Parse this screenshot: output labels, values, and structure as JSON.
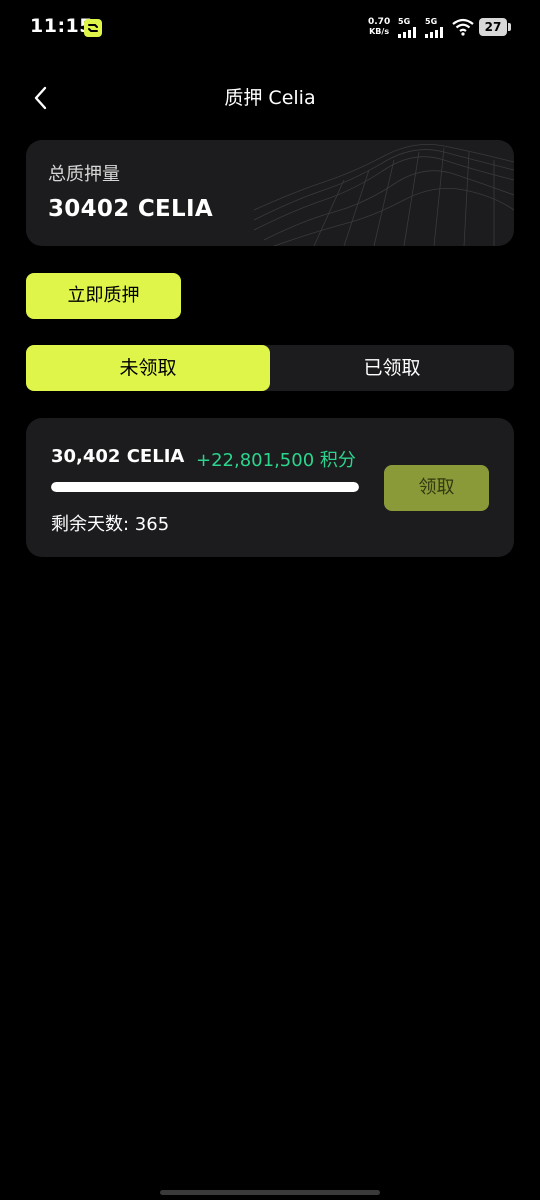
{
  "status_bar": {
    "time": "11:15",
    "net_speed_value": "0.70",
    "net_speed_unit": "KB/s",
    "signal_1_label": "5G",
    "signal_2_label": "5G",
    "battery": "27"
  },
  "header": {
    "title": "质押 Celia",
    "back_icon": "chevron-left-icon"
  },
  "total": {
    "label": "总质押量",
    "value": "30402 CELIA"
  },
  "actions": {
    "stake_now": "立即质押"
  },
  "tabs": [
    {
      "label": "未领取",
      "active": true
    },
    {
      "label": "已领取",
      "active": false
    }
  ],
  "records": [
    {
      "amount": "30,402 CELIA",
      "points": "+22,801,500 积分",
      "progress_percent": 100,
      "days_remaining": "剩余天数: 365",
      "claim_label": "领取"
    }
  ],
  "colors": {
    "accent": "#dff54a",
    "points_green": "#2bd58c",
    "card_bg": "#1c1c1e",
    "claim_disabled": "#8b9a38"
  }
}
